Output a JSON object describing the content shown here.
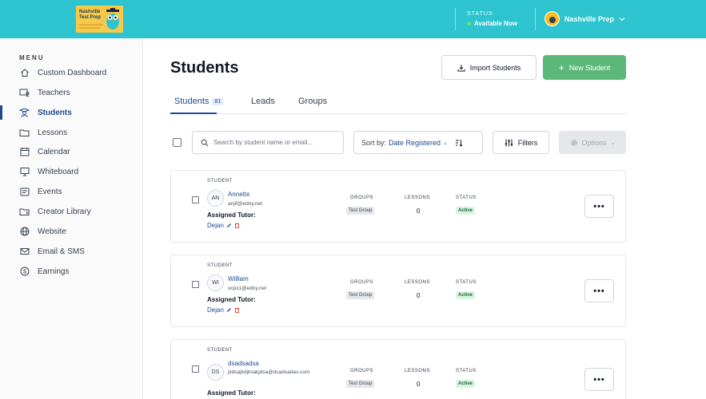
{
  "header": {
    "logo_text": "Nashville Test Prep",
    "status_label": "STATUS",
    "status_value": "Available Now",
    "org_name": "Nashville Prep"
  },
  "sidebar": {
    "menu_title": "MENU",
    "items": [
      {
        "label": "Custom Dashboard",
        "icon": "home-icon"
      },
      {
        "label": "Teachers",
        "icon": "teachers-icon"
      },
      {
        "label": "Students",
        "icon": "students-icon",
        "active": true
      },
      {
        "label": "Lessons",
        "icon": "folder-icon"
      },
      {
        "label": "Calendar",
        "icon": "calendar-icon"
      },
      {
        "label": "Whiteboard",
        "icon": "whiteboard-icon"
      },
      {
        "label": "Events",
        "icon": "events-icon"
      },
      {
        "label": "Creator Library",
        "icon": "library-icon"
      },
      {
        "label": "Website",
        "icon": "globe-icon"
      },
      {
        "label": "Email & SMS",
        "icon": "mail-icon"
      },
      {
        "label": "Earnings",
        "icon": "dollar-icon"
      }
    ]
  },
  "main": {
    "title": "Students",
    "import_label": "Import Students",
    "new_label": "New Student",
    "tabs": [
      {
        "label": "Students",
        "count": "81"
      },
      {
        "label": "Leads"
      },
      {
        "label": "Groups"
      }
    ],
    "search_placeholder": "Search by student name or email...",
    "sort_label": "Sort by:",
    "sort_value": "Date Registered",
    "filters_label": "Filters",
    "options_label": "Options"
  },
  "columns": {
    "student": "STUDENT",
    "groups": "GROUPS",
    "lessons": "LESSONS",
    "status": "STATUS",
    "assigned_tutor": "Assigned Tutor:"
  },
  "students": [
    {
      "initials": "AN",
      "name": "Annette",
      "email": "anjif@edny.net",
      "tutor": "Dejan",
      "group": "Test Group",
      "lessons": "0",
      "status": "Active"
    },
    {
      "initials": "WI",
      "name": "William",
      "email": "vcpx1@edny.net",
      "tutor": "Dejan",
      "group": "Test Group",
      "lessons": "0",
      "status": "Active"
    },
    {
      "initials": "DS",
      "name": "dsadsadsa",
      "email": "jkdsajkdjksakjdsa@dsadsadas.com",
      "tutor": "",
      "group": "Test Group",
      "lessons": "0",
      "status": "Active"
    }
  ],
  "colors": {
    "header": "#2ec4cf",
    "accent": "#1e4b8f",
    "primary_button": "#5cb87a",
    "active_badge": "#dcf5e3"
  }
}
